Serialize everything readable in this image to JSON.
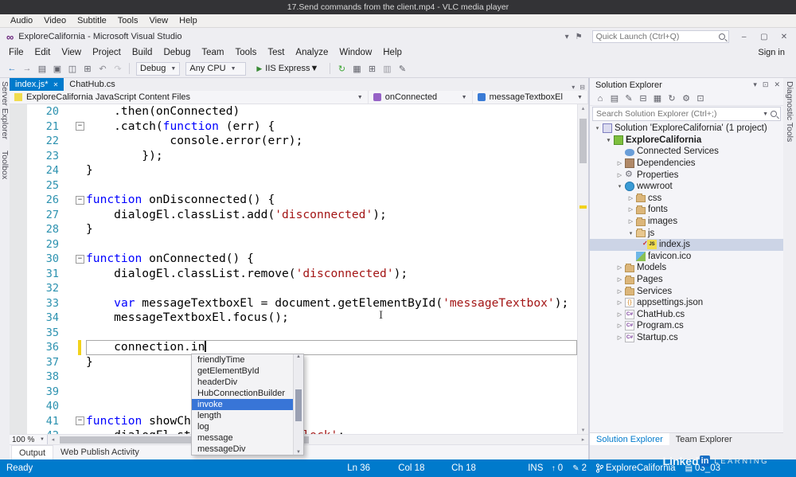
{
  "vlc": {
    "title": "17.Send commands from the client.mp4 - VLC media player",
    "menu": [
      "Audio",
      "Video",
      "Subtitle",
      "Tools",
      "View",
      "Help"
    ]
  },
  "vs": {
    "title": "ExploreCalifornia - Microsoft Visual Studio",
    "quick_launch": "Quick Launch (Ctrl+Q)",
    "sign_in": "Sign in",
    "menu": [
      "File",
      "Edit",
      "View",
      "Project",
      "Build",
      "Debug",
      "Team",
      "Tools",
      "Test",
      "Analyze",
      "Window",
      "Help"
    ],
    "toolbar": {
      "left_icons": [
        {
          "name": "nav-back-icon",
          "glyph": "←",
          "color": "#2b79c2"
        },
        {
          "name": "nav-forward-icon",
          "glyph": "→",
          "color": "#8a8a92"
        },
        {
          "name": "new-file-icon",
          "glyph": "▤",
          "color": "#5f6069"
        },
        {
          "name": "open-file-icon",
          "glyph": "▣",
          "color": "#5f6069"
        },
        {
          "name": "save-icon",
          "glyph": "◫",
          "color": "#5f6069"
        },
        {
          "name": "save-all-icon",
          "glyph": "⊞",
          "color": "#5f6069"
        },
        {
          "name": "undo-icon",
          "glyph": "↶",
          "color": "#8a8a92"
        },
        {
          "name": "redo-icon",
          "glyph": "↷",
          "color": "#c0c0c6"
        }
      ],
      "debug_target": "Debug",
      "platform": "Any CPU",
      "run_label": "IIS Express",
      "right_icons": [
        {
          "name": "browser-link-refresh-icon",
          "glyph": "↻",
          "color": "#3fa737"
        },
        {
          "name": "build-icon",
          "glyph": "▦",
          "color": "#5f6069"
        },
        {
          "name": "attach-icon",
          "glyph": "⊞",
          "color": "#5f6069"
        },
        {
          "name": "find-icon",
          "glyph": "▥",
          "color": "#9a9aa2"
        },
        {
          "name": "comment-icon",
          "glyph": "✎",
          "color": "#5f6069"
        }
      ]
    }
  },
  "side_tabs": {
    "left": [
      "Server Explorer",
      "Toolbox"
    ],
    "right": [
      "Diagnostic Tools"
    ]
  },
  "editor": {
    "tabs": [
      {
        "label": "index.js*",
        "active": true
      },
      {
        "label": "ChatHub.cs",
        "active": false
      }
    ],
    "breadcrumbs": [
      {
        "icon": "js-file-icon",
        "label": "ExploreCalifornia JavaScript Content Files"
      },
      {
        "icon": "method-icon",
        "label": "onConnected"
      },
      {
        "icon": "field-icon",
        "label": "messageTextboxEl"
      }
    ],
    "zoom": "100 %",
    "lines": [
      {
        "num": 20,
        "tokens": [
          [
            "p",
            "    .then(onConnected)"
          ]
        ]
      },
      {
        "num": 21,
        "fold": true,
        "tokens": [
          [
            "p",
            "    .catch("
          ],
          [
            "k",
            "function"
          ],
          [
            "p",
            " (err) {"
          ]
        ]
      },
      {
        "num": 22,
        "tokens": [
          [
            "p",
            "            console.error(err);"
          ]
        ]
      },
      {
        "num": 23,
        "tokens": [
          [
            "p",
            "        });"
          ]
        ]
      },
      {
        "num": 24,
        "tokens": [
          [
            "p",
            "}"
          ]
        ]
      },
      {
        "num": 25,
        "tokens": []
      },
      {
        "num": 26,
        "fold": true,
        "tokens": [
          [
            "k",
            "function"
          ],
          [
            "p",
            " onDisconnected() {"
          ]
        ]
      },
      {
        "num": 27,
        "tokens": [
          [
            "p",
            "    dialogEl.classList.add("
          ],
          [
            "s",
            "'disconnected'"
          ],
          [
            "p",
            ");"
          ]
        ]
      },
      {
        "num": 28,
        "tokens": [
          [
            "p",
            "}"
          ]
        ]
      },
      {
        "num": 29,
        "tokens": []
      },
      {
        "num": 30,
        "fold": true,
        "tokens": [
          [
            "k",
            "function"
          ],
          [
            "p",
            " onConnected() {"
          ]
        ]
      },
      {
        "num": 31,
        "tokens": [
          [
            "p",
            "    dialogEl.classList.remove("
          ],
          [
            "s",
            "'disconnected'"
          ],
          [
            "p",
            ");"
          ]
        ]
      },
      {
        "num": 32,
        "tokens": []
      },
      {
        "num": 33,
        "tokens": [
          [
            "p",
            "    "
          ],
          [
            "k",
            "var"
          ],
          [
            "p",
            " messageTextboxEl = document.getElementById("
          ],
          [
            "s",
            "'messageTextbox'"
          ],
          [
            "p",
            ");"
          ]
        ]
      },
      {
        "num": 34,
        "tokens": [
          [
            "p",
            "    messageTextboxEl.focus();"
          ]
        ]
      },
      {
        "num": 35,
        "tokens": []
      },
      {
        "num": 36,
        "current": true,
        "changed": true,
        "caret": true,
        "tokens": [
          [
            "p",
            "    connection.in"
          ]
        ]
      },
      {
        "num": 37,
        "tokens": [
          [
            "p",
            "}"
          ]
        ]
      },
      {
        "num": 38,
        "tokens": []
      },
      {
        "num": 39,
        "tokens": []
      },
      {
        "num": 40,
        "tokens": []
      },
      {
        "num": 41,
        "fold": true,
        "tokens": [
          [
            "k",
            "function"
          ],
          [
            "p",
            " showCh"
          ]
        ]
      },
      {
        "num": 42,
        "tokens": [
          [
            "p",
            "    dialogEl.style.display = "
          ],
          [
            "s",
            "'block'"
          ],
          [
            "p",
            ";"
          ]
        ]
      }
    ]
  },
  "intellisense": {
    "items": [
      "friendlyTime",
      "getElementById",
      "headerDiv",
      "HubConnectionBuilder",
      "invoke",
      "length",
      "log",
      "message",
      "messageDiv"
    ],
    "selected": "invoke"
  },
  "solution_explorer": {
    "title": "Solution Explorer",
    "header_icons": [
      {
        "name": "window-position-icon",
        "glyph": "▾"
      },
      {
        "name": "pin-icon",
        "glyph": "⊡"
      },
      {
        "name": "close-icon",
        "glyph": "✕"
      }
    ],
    "toolbar_icons": [
      {
        "name": "home-icon",
        "glyph": "⌂"
      },
      {
        "name": "switch-views-icon",
        "glyph": "▤"
      },
      {
        "name": "pending-changes-icon",
        "glyph": "✎"
      },
      {
        "name": "collapse-all-icon",
        "glyph": "⊟"
      },
      {
        "name": "show-all-files-icon",
        "glyph": "▦"
      },
      {
        "name": "refresh-icon",
        "glyph": "↻"
      },
      {
        "name": "properties-icon",
        "glyph": "⚙"
      },
      {
        "name": "preview-icon",
        "glyph": "⊡"
      }
    ],
    "search_placeholder": "Search Solution Explorer (Ctrl+;)",
    "tree": [
      {
        "indent": 0,
        "arrow": "down",
        "icon": "solution",
        "label": "Solution 'ExploreCalifornia' (1 project)"
      },
      {
        "indent": 1,
        "arrow": "down",
        "icon": "project-cs",
        "label": "ExploreCalifornia",
        "bold": true
      },
      {
        "indent": 2,
        "arrow": "none",
        "icon": "connected-services",
        "label": "Connected Services"
      },
      {
        "indent": 2,
        "arrow": "right",
        "icon": "dependencies",
        "label": "Dependencies"
      },
      {
        "indent": 2,
        "arrow": "right",
        "icon": "properties",
        "label": "Properties"
      },
      {
        "indent": 2,
        "arrow": "down",
        "icon": "globe",
        "label": "wwwroot"
      },
      {
        "indent": 3,
        "arrow": "right",
        "icon": "folder",
        "label": "css"
      },
      {
        "indent": 3,
        "arrow": "right",
        "icon": "folder",
        "label": "fonts"
      },
      {
        "indent": 3,
        "arrow": "right",
        "icon": "folder",
        "label": "images"
      },
      {
        "indent": 3,
        "arrow": "down",
        "icon": "folder-open",
        "label": "js"
      },
      {
        "indent": 4,
        "arrow": "none",
        "icon": "js-file",
        "label": "index.js",
        "selected": true,
        "status": "modified"
      },
      {
        "indent": 3,
        "arrow": "none",
        "icon": "image-file",
        "label": "favicon.ico"
      },
      {
        "indent": 2,
        "arrow": "right",
        "icon": "folder",
        "label": "Models"
      },
      {
        "indent": 2,
        "arrow": "right",
        "icon": "folder",
        "label": "Pages"
      },
      {
        "indent": 2,
        "arrow": "right",
        "icon": "folder",
        "label": "Services"
      },
      {
        "indent": 2,
        "arrow": "right",
        "icon": "json-file",
        "label": "appsettings.json"
      },
      {
        "indent": 2,
        "arrow": "right",
        "icon": "cs-file",
        "label": "ChatHub.cs"
      },
      {
        "indent": 2,
        "arrow": "right",
        "icon": "cs-file",
        "label": "Program.cs"
      },
      {
        "indent": 2,
        "arrow": "right",
        "icon": "cs-file",
        "label": "Startup.cs"
      }
    ],
    "bottom_tabs": [
      {
        "label": "Solution Explorer",
        "active": true
      },
      {
        "label": "Team Explorer",
        "active": false
      }
    ]
  },
  "output_tabs": [
    "Output",
    "Web Publish Activity"
  ],
  "statusbar": {
    "ready": "Ready",
    "ln": "Ln 36",
    "col": "Col 18",
    "ch": "Ch 18",
    "mode": "INS",
    "publish_count": "0",
    "edit_count": "2",
    "branch": "ExploreCalifornia",
    "repo": "03_03"
  },
  "watermark": {
    "linked": "Linked",
    "in": "in",
    "learning": "LEARNING"
  },
  "colors": {
    "accent": "#007acc",
    "keyword": "#0000ff",
    "string": "#a31515",
    "line_number": "#2b91af",
    "selection": "#3875d7"
  }
}
